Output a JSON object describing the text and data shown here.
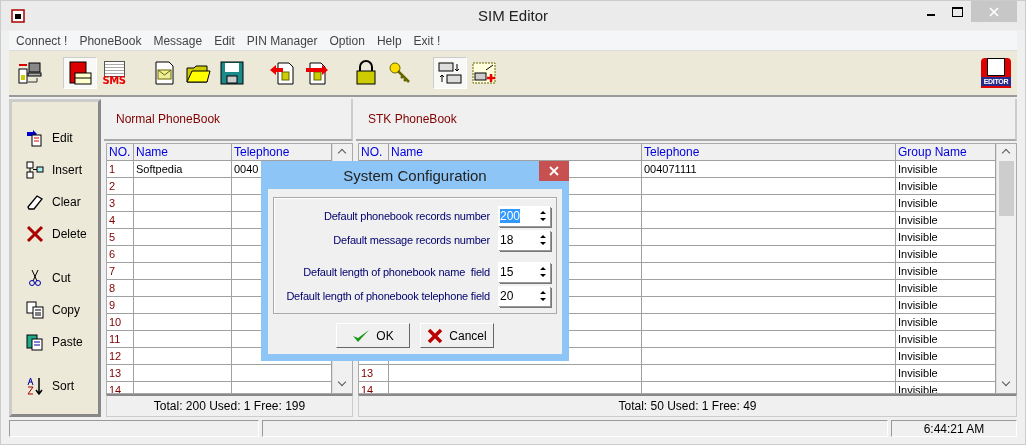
{
  "window": {
    "title": "SIM Editor"
  },
  "menu": [
    "Connect !",
    "PhoneBook",
    "Message",
    "Edit",
    "PIN Manager",
    "Option",
    "Help",
    "Exit !"
  ],
  "toolbar": [
    [
      {
        "kind": "sim-pc",
        "selected": false
      }
    ],
    [
      {
        "kind": "phonebook",
        "selected": true
      },
      {
        "kind": "sms",
        "selected": false,
        "label": "SMS"
      }
    ],
    [
      {
        "kind": "message",
        "selected": false
      },
      {
        "kind": "open",
        "selected": false
      },
      {
        "kind": "save",
        "selected": false
      }
    ],
    [
      {
        "kind": "sim-in",
        "selected": false
      },
      {
        "kind": "sim-out",
        "selected": false
      }
    ],
    [
      {
        "kind": "lock",
        "selected": false
      },
      {
        "kind": "key",
        "selected": false
      }
    ],
    [
      {
        "kind": "swap",
        "selected": true
      },
      {
        "kind": "card-add",
        "selected": false
      }
    ]
  ],
  "logo": {
    "label": "EDITOR"
  },
  "sidebar": [
    [
      {
        "kind": "edit",
        "label": "Edit"
      },
      {
        "kind": "insert",
        "label": "Insert"
      },
      {
        "kind": "clear",
        "label": "Clear"
      },
      {
        "kind": "delete",
        "label": "Delete"
      }
    ],
    [
      {
        "kind": "cut",
        "label": "Cut"
      },
      {
        "kind": "copy",
        "label": "Copy"
      },
      {
        "kind": "paste",
        "label": "Paste"
      }
    ],
    [
      {
        "kind": "sort",
        "label": "Sort"
      }
    ]
  ],
  "normal_phonebook": {
    "title": "Normal PhoneBook",
    "columns": [
      "NO.",
      "Name",
      "Telephone"
    ],
    "rows": [
      {
        "no": "1",
        "name": "Softpedia",
        "telephone": "0040"
      },
      {
        "no": "2"
      },
      {
        "no": "3"
      },
      {
        "no": "4"
      },
      {
        "no": "5"
      },
      {
        "no": "6"
      },
      {
        "no": "7"
      },
      {
        "no": "8"
      },
      {
        "no": "9"
      },
      {
        "no": "10"
      },
      {
        "no": "11"
      },
      {
        "no": "12"
      },
      {
        "no": "13"
      },
      {
        "no": "14"
      }
    ],
    "footer": "Total: 200  Used: 1  Free: 199"
  },
  "stk_phonebook": {
    "title": "STK PhoneBook",
    "columns": [
      "NO.",
      "Name",
      "Telephone",
      "Group Name"
    ],
    "rows": [
      {
        "telephone": "004071111",
        "group": "Invisible"
      },
      {
        "group": "Invisible"
      },
      {
        "group": "Invisible"
      },
      {
        "group": "Invisible"
      },
      {
        "group": "Invisible"
      },
      {
        "group": "Invisible"
      },
      {
        "group": "Invisible"
      },
      {
        "group": "Invisible"
      },
      {
        "group": "Invisible"
      },
      {
        "group": "Invisible"
      },
      {
        "group": "Invisible"
      },
      {
        "group": "Invisible"
      },
      {
        "no": "13",
        "group": "Invisible"
      },
      {
        "no": "14",
        "group": "Invisible"
      }
    ],
    "footer": "Total: 50  Used: 1  Free: 49"
  },
  "status_bar": {
    "time": "6:44:21 AM"
  },
  "dialog": {
    "title": "System Configuration",
    "fields": [
      [
        {
          "label": "Default phonebook records number",
          "value": "200",
          "selected": true
        },
        {
          "label": "Default message records number",
          "value": "18",
          "selected": false
        }
      ],
      [
        {
          "label": "Default length of phonebook name  field",
          "value": "15",
          "selected": false
        },
        {
          "label": "Default length of phonebook telephone field",
          "value": "20",
          "selected": false
        }
      ]
    ],
    "buttons": [
      {
        "kind": "ok",
        "label": "OK"
      },
      {
        "kind": "cancel",
        "label": "Cancel"
      }
    ]
  }
}
